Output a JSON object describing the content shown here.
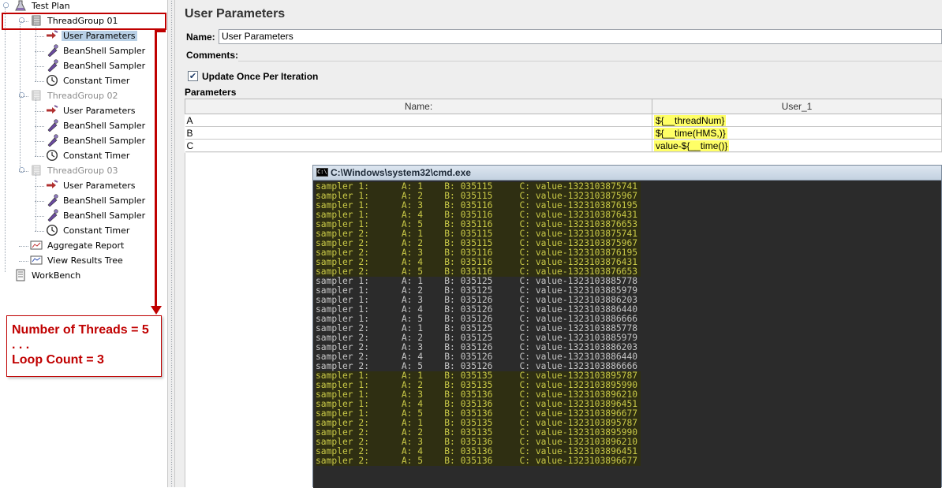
{
  "tree": {
    "items": [
      {
        "label": "Test Plan",
        "icon": "test-plan-icon",
        "level": 0,
        "state": "normal"
      },
      {
        "label": "ThreadGroup 01",
        "icon": "thread-group-icon",
        "level": 1,
        "state": "normal"
      },
      {
        "label": "User Parameters",
        "icon": "user-parameters-icon",
        "level": 2,
        "state": "selected"
      },
      {
        "label": "BeanShell Sampler",
        "icon": "beanshell-sampler-icon",
        "level": 2,
        "state": "normal"
      },
      {
        "label": "BeanShell Sampler",
        "icon": "beanshell-sampler-icon",
        "level": 2,
        "state": "normal"
      },
      {
        "label": "Constant Timer",
        "icon": "constant-timer-icon",
        "level": 2,
        "state": "normal"
      },
      {
        "label": "ThreadGroup 02",
        "icon": "thread-group-icon",
        "level": 1,
        "state": "disabled"
      },
      {
        "label": "User Parameters",
        "icon": "user-parameters-icon",
        "level": 2,
        "state": "normal"
      },
      {
        "label": "BeanShell Sampler",
        "icon": "beanshell-sampler-icon",
        "level": 2,
        "state": "normal"
      },
      {
        "label": "BeanShell Sampler",
        "icon": "beanshell-sampler-icon",
        "level": 2,
        "state": "normal"
      },
      {
        "label": "Constant Timer",
        "icon": "constant-timer-icon",
        "level": 2,
        "state": "normal"
      },
      {
        "label": "ThreadGroup 03",
        "icon": "thread-group-icon",
        "level": 1,
        "state": "disabled"
      },
      {
        "label": "User Parameters",
        "icon": "user-parameters-icon",
        "level": 2,
        "state": "normal"
      },
      {
        "label": "BeanShell Sampler",
        "icon": "beanshell-sampler-icon",
        "level": 2,
        "state": "normal"
      },
      {
        "label": "BeanShell Sampler",
        "icon": "beanshell-sampler-icon",
        "level": 2,
        "state": "normal"
      },
      {
        "label": "Constant Timer",
        "icon": "constant-timer-icon",
        "level": 2,
        "state": "normal"
      },
      {
        "label": "Aggregate Report",
        "icon": "aggregate-report-icon",
        "level": 1,
        "state": "normal"
      },
      {
        "label": "View Results Tree",
        "icon": "view-results-tree-icon",
        "level": 1,
        "state": "normal"
      },
      {
        "label": "WorkBench",
        "icon": "workbench-icon",
        "level": 0,
        "state": "normal"
      }
    ]
  },
  "annotation": {
    "line1": "Number of Threads = 5",
    "line2": ". . .",
    "line3": "Loop Count = 3",
    "color": "#c00000"
  },
  "panel": {
    "title": "User Parameters",
    "name_label": "Name:",
    "name_value": "User Parameters",
    "comments_label": "Comments:",
    "comments_value": "",
    "update_once_label": "Update Once Per Iteration",
    "update_once_checked": true,
    "parameters_label": "Parameters"
  },
  "params_table": {
    "headers": [
      "Name:",
      "User_1"
    ],
    "rows": [
      {
        "name": "A",
        "value": "${__threadNum}"
      },
      {
        "name": "B",
        "value": "${__time(HMS,)}"
      },
      {
        "name": "C",
        "value": "value-${__time()}"
      }
    ],
    "highlight_color": "#ffff66"
  },
  "cmd": {
    "title": "C:\\Windows\\system32\\cmd.exe",
    "icon": "cmd-icon",
    "lines": [
      {
        "text": "sampler 1:      A: 1    B: 035115     C: value-1323103875741",
        "style": "y"
      },
      {
        "text": "sampler 1:      A: 2    B: 035115     C: value-1323103875967",
        "style": "y"
      },
      {
        "text": "sampler 1:      A: 3    B: 035116     C: value-1323103876195",
        "style": "y"
      },
      {
        "text": "sampler 1:      A: 4    B: 035116     C: value-1323103876431",
        "style": "y"
      },
      {
        "text": "sampler 1:      A: 5    B: 035116     C: value-1323103876653",
        "style": "y"
      },
      {
        "text": "sampler 2:      A: 1    B: 035115     C: value-1323103875741",
        "style": "y"
      },
      {
        "text": "sampler 2:      A: 2    B: 035115     C: value-1323103875967",
        "style": "y"
      },
      {
        "text": "sampler 2:      A: 3    B: 035116     C: value-1323103876195",
        "style": "y"
      },
      {
        "text": "sampler 2:      A: 4    B: 035116     C: value-1323103876431",
        "style": "y"
      },
      {
        "text": "sampler 2:      A: 5    B: 035116     C: value-1323103876653",
        "style": "y"
      },
      {
        "text": "sampler 1:      A: 1    B: 035125     C: value-1323103885778",
        "style": "g"
      },
      {
        "text": "sampler 1:      A: 2    B: 035125     C: value-1323103885979",
        "style": "g"
      },
      {
        "text": "sampler 1:      A: 3    B: 035126     C: value-1323103886203",
        "style": "g"
      },
      {
        "text": "sampler 1:      A: 4    B: 035126     C: value-1323103886440",
        "style": "g"
      },
      {
        "text": "sampler 1:      A: 5    B: 035126     C: value-1323103886666",
        "style": "g"
      },
      {
        "text": "sampler 2:      A: 1    B: 035125     C: value-1323103885778",
        "style": "g"
      },
      {
        "text": "sampler 2:      A: 2    B: 035125     C: value-1323103885979",
        "style": "g"
      },
      {
        "text": "sampler 2:      A: 3    B: 035126     C: value-1323103886203",
        "style": "g"
      },
      {
        "text": "sampler 2:      A: 4    B: 035126     C: value-1323103886440",
        "style": "g"
      },
      {
        "text": "sampler 2:      A: 5    B: 035126     C: value-1323103886666",
        "style": "g"
      },
      {
        "text": "sampler 1:      A: 1    B: 035135     C: value-1323103895787",
        "style": "y"
      },
      {
        "text": "sampler 1:      A: 2    B: 035135     C: value-1323103895990",
        "style": "y"
      },
      {
        "text": "sampler 1:      A: 3    B: 035136     C: value-1323103896210",
        "style": "y"
      },
      {
        "text": "sampler 1:      A: 4    B: 035136     C: value-1323103896451",
        "style": "y"
      },
      {
        "text": "sampler 1:      A: 5    B: 035136     C: value-1323103896677",
        "style": "y"
      },
      {
        "text": "sampler 2:      A: 1    B: 035135     C: value-1323103895787",
        "style": "y"
      },
      {
        "text": "sampler 2:      A: 2    B: 035135     C: value-1323103895990",
        "style": "y"
      },
      {
        "text": "sampler 2:      A: 3    B: 035136     C: value-1323103896210",
        "style": "y"
      },
      {
        "text": "sampler 2:      A: 4    B: 035136     C: value-1323103896451",
        "style": "y"
      },
      {
        "text": "sampler 2:      A: 5    B: 035136     C: value-1323103896677",
        "style": "y"
      }
    ]
  }
}
